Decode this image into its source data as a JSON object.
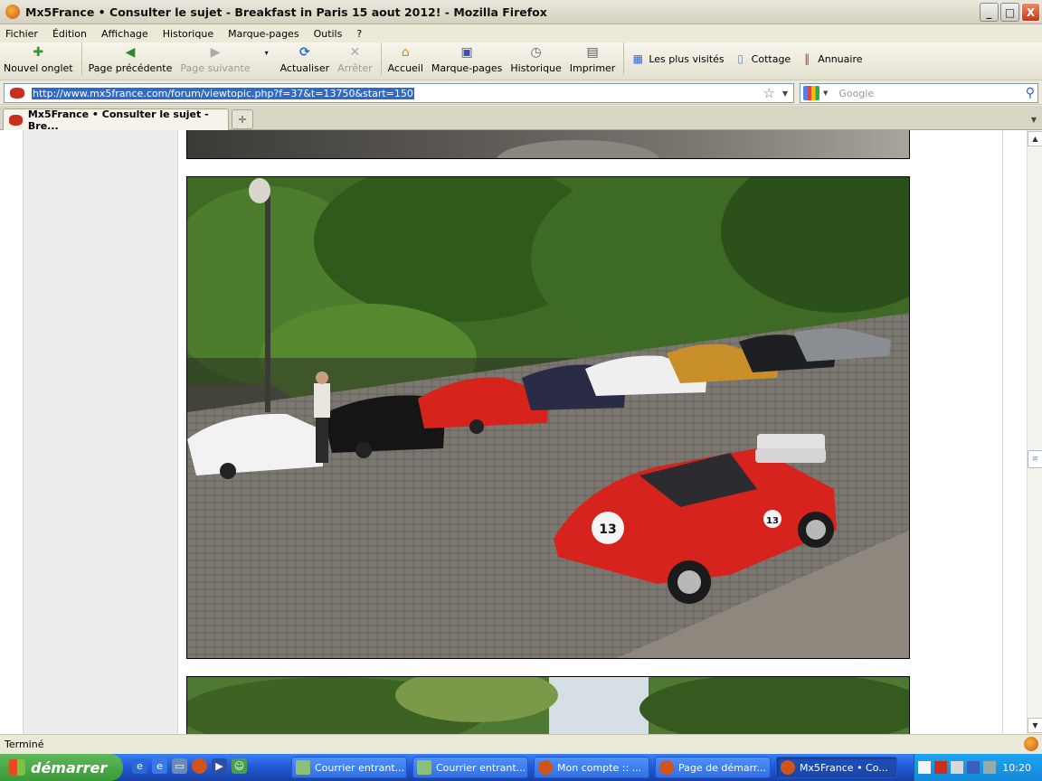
{
  "window": {
    "title": "Mx5France • Consulter le sujet - Breakfast in Paris 15 aout 2012! - Mozilla Firefox",
    "controls": [
      "_",
      "□",
      "X"
    ]
  },
  "menu": [
    "Fichier",
    "Édition",
    "Affichage",
    "Historique",
    "Marque-pages",
    "Outils",
    "?"
  ],
  "toolbar": {
    "new_tab": "Nouvel onglet",
    "back": "Page précédente",
    "forward": "Page suivante",
    "reload": "Actualiser",
    "stop": "Arrêter",
    "home": "Accueil",
    "bookmarks": "Marque-pages",
    "history": "Historique",
    "print": "Imprimer",
    "bm1": "Les plus visités",
    "bm2": "Cottage",
    "bm3": "Annuaire"
  },
  "address": {
    "url": "http://www.mx5france.com/forum/viewtopic.php?f=37&t=13750&start=150",
    "search_placeholder": "Google"
  },
  "tabs": [
    {
      "label": "Mx5France • Consulter le sujet - Bre...",
      "active": true
    }
  ],
  "status": {
    "text": "Terminé"
  },
  "taskbar": {
    "start": "démarrer",
    "tasks": [
      {
        "label": "Courrier entrant...",
        "active": false
      },
      {
        "label": "Courrier entrant...",
        "active": false
      },
      {
        "label": "Mon compte :: ...",
        "active": false
      },
      {
        "label": "Page de démarr...",
        "active": false
      },
      {
        "label": "Mx5France • Co...",
        "active": true
      }
    ],
    "clock": "10:20"
  },
  "colors": {
    "accent_blue": "#245edb",
    "start_green": "#3a9a36",
    "selection": "#316ac5"
  }
}
